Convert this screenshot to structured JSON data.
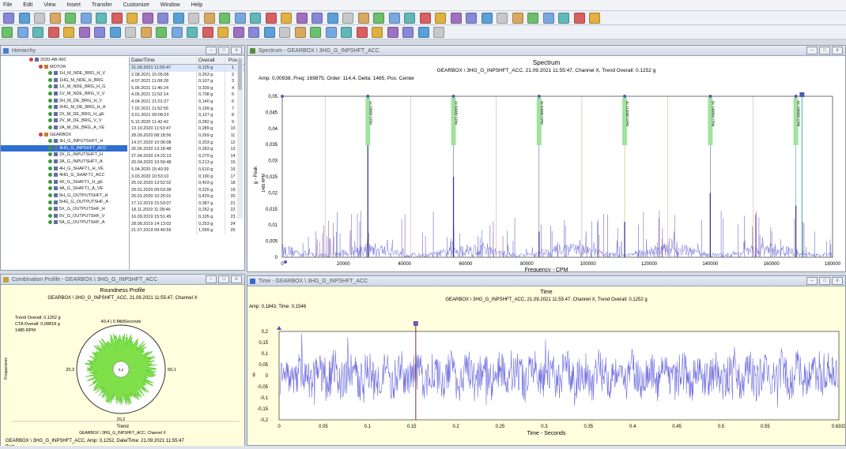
{
  "menu": [
    "File",
    "Edit",
    "View",
    "Insert",
    "Transfer",
    "Customize",
    "Window",
    "Help"
  ],
  "hierarchy": {
    "title": "Hierarchy",
    "tree": [
      {
        "label": "2020-AB-960",
        "depth": 0,
        "kind": "machine"
      },
      {
        "label": "MOTOR",
        "depth": 1,
        "kind": "group"
      },
      {
        "label": "1H_M_NDE_BRG_H_V",
        "depth": 2,
        "kind": "point"
      },
      {
        "label": "1HG_M_NDE_H_BRG",
        "depth": 2,
        "kind": "point"
      },
      {
        "label": "1X_M_NDE_BRG_H_G",
        "depth": 2,
        "kind": "point"
      },
      {
        "label": "1V_M_NDE_BRG_V_V",
        "depth": 2,
        "kind": "point"
      },
      {
        "label": "2H_M_DE_BRG_H_V",
        "depth": 2,
        "kind": "point"
      },
      {
        "label": "2HG_M_DE_BRG_H_A",
        "depth": 2,
        "kind": "point"
      },
      {
        "label": "2X_M_DE_BRG_H_gE",
        "depth": 2,
        "kind": "point"
      },
      {
        "label": "2V_M_DE_BRG_V_V",
        "depth": 2,
        "kind": "point"
      },
      {
        "label": "2A_M_DE_BRG_A_VE",
        "depth": 2,
        "kind": "point"
      },
      {
        "label": "GEARBOX",
        "depth": 1,
        "kind": "group"
      },
      {
        "label": "3H_G_INPUTSHFT_H",
        "depth": 2,
        "kind": "point"
      },
      {
        "label": "3HG_G_INPSHFT_ACC",
        "depth": 2,
        "kind": "selected"
      },
      {
        "label": "3X_G_INPUTSHFT_H",
        "depth": 2,
        "kind": "point"
      },
      {
        "label": "3A_G_INPUTSHFT_A",
        "depth": 2,
        "kind": "point"
      },
      {
        "label": "4H_G_SHAFT1_H_VE",
        "depth": 2,
        "kind": "point"
      },
      {
        "label": "4HG_G_SHAFT1_ACC",
        "depth": 2,
        "kind": "point"
      },
      {
        "label": "4X_G_SHAFT1_H_gE",
        "depth": 2,
        "kind": "point"
      },
      {
        "label": "4A_G_SHAFT1_A_VE",
        "depth": 2,
        "kind": "point"
      },
      {
        "label": "5H_G_OUTPUTSHFT_H",
        "depth": 2,
        "kind": "point"
      },
      {
        "label": "5HG_G_OUTPUTSHF_A",
        "depth": 2,
        "kind": "point"
      },
      {
        "label": "5X_G_OUTPUTSHF_H",
        "depth": 2,
        "kind": "point"
      },
      {
        "label": "5V_G_OUTPUTSHF_V",
        "depth": 2,
        "kind": "point"
      },
      {
        "label": "5A_G_OUTPUTSHF_A",
        "depth": 2,
        "kind": "point"
      }
    ],
    "columns": [
      "Date/Time",
      "Overall",
      "Pos"
    ],
    "rows": [
      [
        "21.09.2021 11:55:47",
        "0,125 g",
        "1"
      ],
      [
        "2.08.2021 15:05:08",
        "0,263 g",
        "2"
      ],
      [
        "4.07.2021 11:08:28",
        "0,107 g",
        "3"
      ],
      [
        "5.06.2021 11:46:24",
        "0,339 g",
        "4"
      ],
      [
        "4.05.2021 11:52:14",
        "0,708 g",
        "5"
      ],
      [
        "4.04.2021 21:01:27",
        "0,140 g",
        "6"
      ],
      [
        "7.02.2021 11:52:55",
        "0,199 g",
        "7"
      ],
      [
        "3.01.2021 09:08:23",
        "0,127 g",
        "8"
      ],
      [
        "5.12.2020 11:42:42",
        "0,282 g",
        "9"
      ],
      [
        "13.10.2020 11:53:47",
        "0,289 g",
        "10"
      ],
      [
        "28.09.2020 08:18:56",
        "0,269 g",
        "11"
      ],
      [
        "14.07.2020 10:06:08",
        "0,203 g",
        "12"
      ],
      [
        "26.06.2020 13:18:48",
        "0,283 g",
        "13"
      ],
      [
        "27.04.2020 14:23:13",
        "0,270 g",
        "14"
      ],
      [
        "20.04.2020 10:59:48",
        "0,213 g",
        "15"
      ],
      [
        "5.04.2020 15:40:39",
        "0,610 g",
        "16"
      ],
      [
        "3.03.2020 10:53:10",
        "0,190 g",
        "17"
      ],
      [
        "25.02.2020 13:52:02",
        "0,403 g",
        "18"
      ],
      [
        "29.01.2020 09:53:38",
        "0,225 g",
        "19"
      ],
      [
        "26.01.2020 10:25:01",
        "0,429 g",
        "20"
      ],
      [
        "17.12.2019 15:53:07",
        "0,387 g",
        "21"
      ],
      [
        "18.11.2019 11:28:46",
        "0,252 g",
        "22"
      ],
      [
        "16.09.2019 15:51:45",
        "0,105 g",
        "23"
      ],
      [
        "28.08.2019 14:13:02",
        "0,253 g",
        "24"
      ],
      [
        "21.07.2019 09:40:59",
        "1,599 g",
        "25"
      ]
    ]
  },
  "spectrum": {
    "window_title": "Spectrum - GEARBOX \\ 3HG_G_INPSHFT_ACC",
    "title": "Spectrum",
    "subtitle": "GEARBOX \\ 3HG_G_INPSHFT_ACC, 21.09.2021 11:55:47, Channel X, Trend Overall: 0.1252 g",
    "info": "Amp: 0,00938, Freq: 169875, Order: 114,4, Delta: 1485, Pos: Center",
    "ylabel": "g - Peak",
    "xlabel": "Frequency - CPM",
    "rpm_label": "1485 RPM",
    "markers": [
      "1x 28000 CPM",
      "2x 56000 CPM",
      "3x 84000 CPM",
      "4x 112000 CPM",
      "5x 140000 CPM",
      "6x 168000 CPM"
    ]
  },
  "orbit": {
    "window_title": "Combination Profile - GEARBOX \\ 3HG_G_INPSHFT_ACC",
    "title": "Roundness Profile",
    "subtitle": "GEARBOX \\ 3HG_G_INPSHFT_ACC, 21.09.2021 11:55:47, Channel X",
    "trend_overall": "Trend Overall: 0,1252 g",
    "cta_overall": "CTA Overall: 0,08818 g",
    "rpm": "1485 RPM",
    "top_label": "40,4 | 0 MilliSeconds",
    "left_label": "20,3",
    "right_label": "60,1",
    "bottom_label": "20,2",
    "center_label": "0,2",
    "side_label": "Frequencies",
    "trend_title": "Trend",
    "trend_sub": "GEARBOX \\ 3HG_G_INPSHFT_ACC, Channel X",
    "trend_info": "GEARBOX \\ 3HG_G_INPSHFT_ACC, Amp: 0,1252, Date/Time: 21.09.2021 11:55:47",
    "trend_side": "Peak"
  },
  "time": {
    "window_title": "Time - GEARBOX \\ 3HG_G_INPSHFT_ACC",
    "title": "Time",
    "subtitle": "GEARBOX \\ 3HG_G_INPSHFT_ACC, 21.09.2021 11:55:47, Channel X, Trend Overall: 0,1252 g",
    "info": "Amp: 0,1843, Time: 0,1546",
    "ylabel": "g",
    "xlabel": "Time - Seconds"
  },
  "colors": {
    "wave": "#6f6fe0",
    "panel": "#fffedd",
    "marker_green": "#9fe39f",
    "orbit_fill": "#7fe04a"
  },
  "chart_data": [
    {
      "type": "line",
      "title": "Spectrum",
      "xlabel": "Frequency - CPM",
      "ylabel": "g - Peak",
      "xlim": [
        0,
        180000
      ],
      "ylim": [
        0,
        0.05
      ],
      "x_ticks": [
        "0",
        "20000",
        "40000",
        "60000",
        "80000",
        "100000",
        "120000",
        "140000",
        "160000",
        "180000"
      ],
      "y_ticks": [
        "0,05",
        "0,045",
        "0,04",
        "0,035",
        "0,03",
        "0,025",
        "0,02",
        "0,015",
        "0,01",
        "0,005",
        "0"
      ],
      "peaks": [
        {
          "x": 28000,
          "y": 0.05
        },
        {
          "x": 56000,
          "y": 0.025
        },
        {
          "x": 84000,
          "y": 0.008
        },
        {
          "x": 112000,
          "y": 0.011
        },
        {
          "x": 140000,
          "y": 0.02
        },
        {
          "x": 168000,
          "y": 0.016
        }
      ]
    },
    {
      "type": "line",
      "title": "Time",
      "xlabel": "Time - Seconds",
      "ylabel": "g",
      "xlim": [
        0,
        0.6333
      ],
      "ylim": [
        -0.2,
        0.2
      ],
      "x_ticks": [
        "0",
        "0.05",
        "0.1",
        "0.15",
        "0.2",
        "0.25",
        "0.3",
        "0.35",
        "0.4",
        "0.45",
        "0.5",
        "0.55",
        "0.6333"
      ],
      "y_ticks": [
        "0,2",
        "0,15",
        "0,1",
        "0,05",
        "0",
        "-0,05",
        "-0,1",
        "-0,15",
        "-0,2"
      ],
      "cursor_x": 0.1546
    }
  ]
}
